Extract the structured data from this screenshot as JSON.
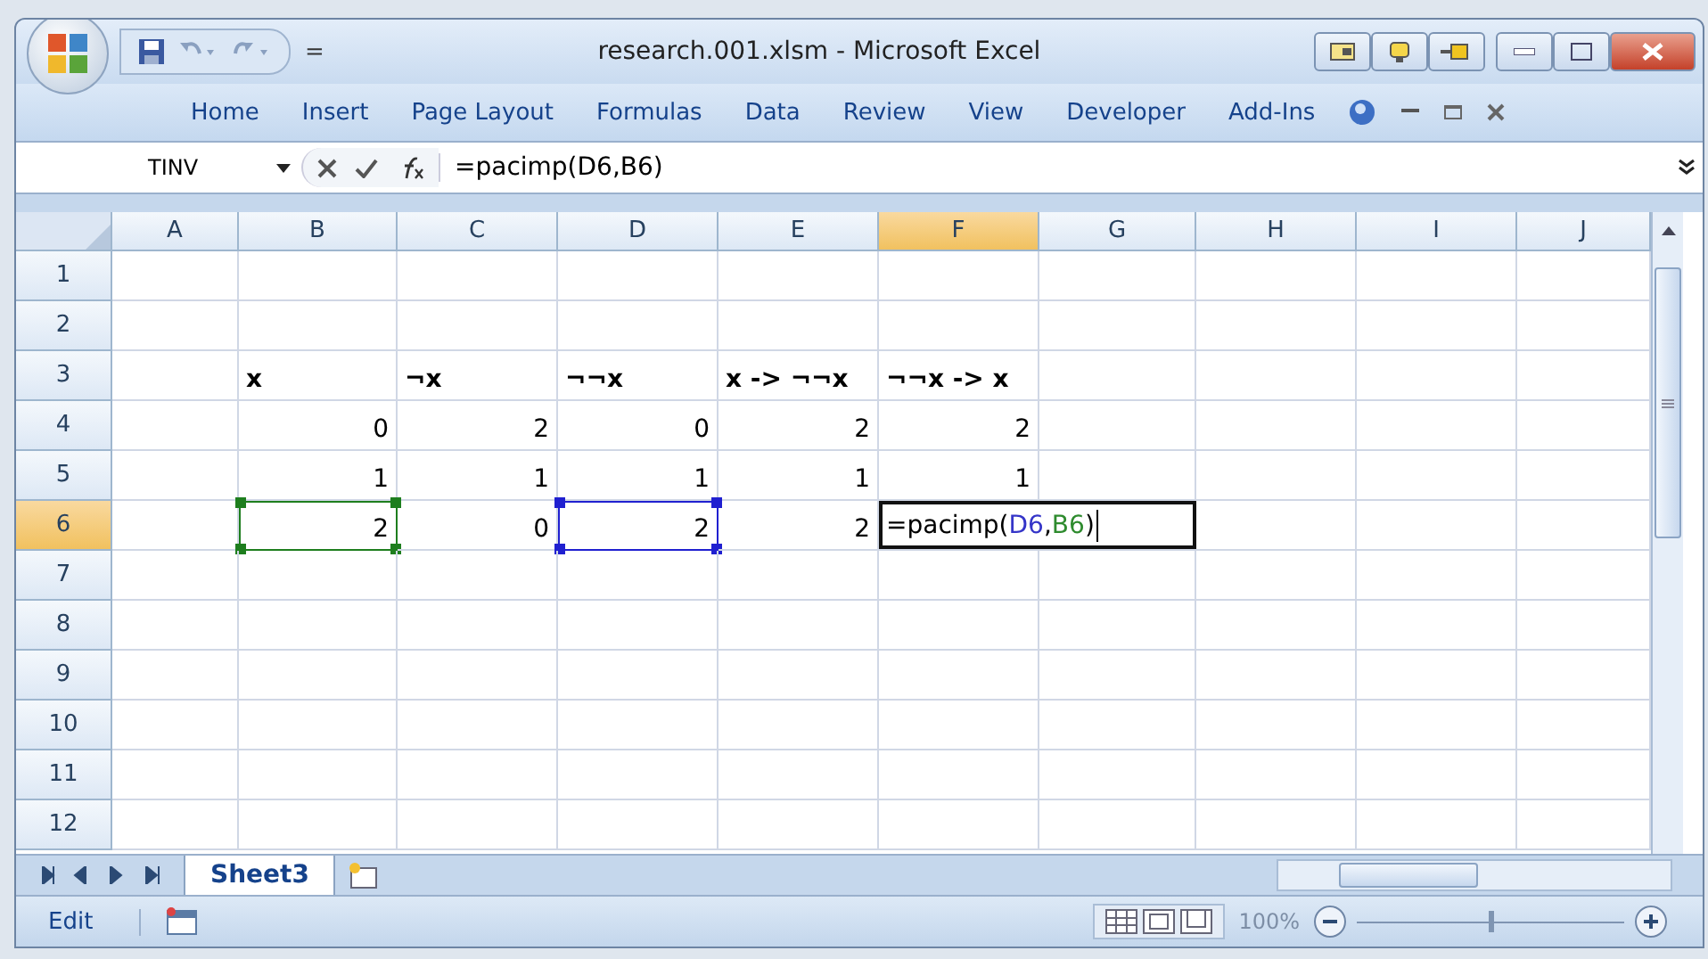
{
  "window": {
    "title": "research.001.xlsm - Microsoft Excel"
  },
  "qat": {
    "separator": "="
  },
  "ribbon_tabs": [
    {
      "label": "Home"
    },
    {
      "label": "Insert"
    },
    {
      "label": "Page Layout"
    },
    {
      "label": "Formulas"
    },
    {
      "label": "Data"
    },
    {
      "label": "Review"
    },
    {
      "label": "View"
    },
    {
      "label": "Developer"
    },
    {
      "label": "Add-Ins"
    }
  ],
  "formula_bar": {
    "name_box": "TINV",
    "formula": "=pacimp(D6,B6)"
  },
  "sheet": {
    "columns": [
      {
        "label": "A",
        "selected": false
      },
      {
        "label": "B",
        "selected": false
      },
      {
        "label": "C",
        "selected": false
      },
      {
        "label": "D",
        "selected": false
      },
      {
        "label": "E",
        "selected": false
      },
      {
        "label": "F",
        "selected": true
      },
      {
        "label": "G",
        "selected": false
      },
      {
        "label": "H",
        "selected": false
      },
      {
        "label": "I",
        "selected": false
      },
      {
        "label": "J",
        "selected": false
      }
    ],
    "rows": [
      {
        "label": "1",
        "selected": false
      },
      {
        "label": "2",
        "selected": false
      },
      {
        "label": "3",
        "selected": false,
        "cells": [
          null,
          {
            "kind": "text",
            "text": "x",
            "bold": true
          },
          {
            "kind": "text",
            "text": "¬x",
            "bold": true
          },
          {
            "kind": "text",
            "text": "¬¬x",
            "bold": true
          },
          {
            "kind": "text",
            "text": "x -> ¬¬x",
            "bold": true
          },
          {
            "kind": "text",
            "text": "¬¬x -> x",
            "bold": true
          }
        ]
      },
      {
        "label": "4",
        "selected": false,
        "cells": [
          null,
          {
            "kind": "number",
            "text": "0"
          },
          {
            "kind": "number",
            "text": "2"
          },
          {
            "kind": "number",
            "text": "0"
          },
          {
            "kind": "number",
            "text": "2"
          },
          {
            "kind": "number",
            "text": "2"
          }
        ]
      },
      {
        "label": "5",
        "selected": false,
        "cells": [
          null,
          {
            "kind": "number",
            "text": "1"
          },
          {
            "kind": "number",
            "text": "1"
          },
          {
            "kind": "number",
            "text": "1"
          },
          {
            "kind": "number",
            "text": "1"
          },
          {
            "kind": "number",
            "text": "1"
          }
        ]
      },
      {
        "label": "6",
        "selected": true,
        "cells": [
          null,
          {
            "kind": "number",
            "text": "2",
            "color": "#1e7e1e"
          },
          {
            "kind": "number",
            "text": "0"
          },
          {
            "kind": "number",
            "text": "2",
            "color": "#2020d0"
          },
          {
            "kind": "number",
            "text": "2"
          },
          {
            "kind": "editing",
            "opening": "=pacimp(",
            "refs": [
              {
                "text": "D6",
                "color": "#3535c8"
              },
              {
                "text": "B6",
                "color": "#2e8b2e"
              }
            ],
            "separator": ",",
            "closing": ")"
          }
        ]
      },
      {
        "label": "7",
        "selected": false
      },
      {
        "label": "8",
        "selected": false
      },
      {
        "label": "9",
        "selected": false
      },
      {
        "label": "10",
        "selected": false
      },
      {
        "label": "11",
        "selected": false
      },
      {
        "label": "12",
        "selected": false
      }
    ]
  },
  "sheet_tabs": [
    {
      "label": "Sheet3",
      "selected": true
    }
  ],
  "status_bar": {
    "mode": "Edit",
    "zoom": "100%",
    "zoom_disabled": true,
    "zoom_slider": {
      "level": 0.5
    }
  }
}
